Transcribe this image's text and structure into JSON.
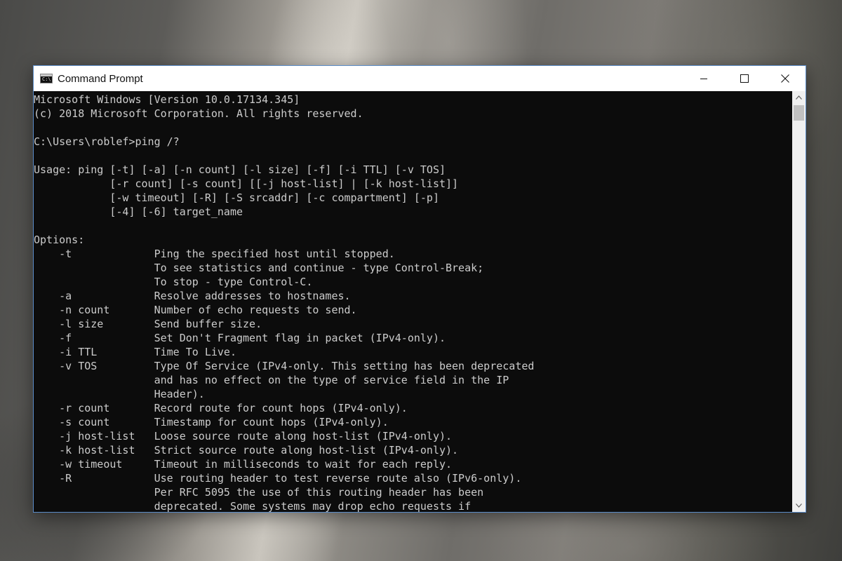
{
  "window": {
    "title": "Command Prompt",
    "icon": "cmd-icon",
    "icon_text": "C:\\"
  },
  "caption_buttons": {
    "minimize_icon": "minimize-icon",
    "maximize_icon": "maximize-icon",
    "close_icon": "close-icon"
  },
  "scrollbar": {
    "up_icon": "chevron-up-icon",
    "down_icon": "chevron-down-icon"
  },
  "console": {
    "lines": [
      "Microsoft Windows [Version 10.0.17134.345]",
      "(c) 2018 Microsoft Corporation. All rights reserved.",
      "",
      "C:\\Users\\roblef>ping /?",
      "",
      "Usage: ping [-t] [-a] [-n count] [-l size] [-f] [-i TTL] [-v TOS]",
      "            [-r count] [-s count] [[-j host-list] | [-k host-list]]",
      "            [-w timeout] [-R] [-S srcaddr] [-c compartment] [-p]",
      "            [-4] [-6] target_name",
      "",
      "Options:",
      "    -t             Ping the specified host until stopped.",
      "                   To see statistics and continue - type Control-Break;",
      "                   To stop - type Control-C.",
      "    -a             Resolve addresses to hostnames.",
      "    -n count       Number of echo requests to send.",
      "    -l size        Send buffer size.",
      "    -f             Set Don't Fragment flag in packet (IPv4-only).",
      "    -i TTL         Time To Live.",
      "    -v TOS         Type Of Service (IPv4-only. This setting has been deprecated",
      "                   and has no effect on the type of service field in the IP",
      "                   Header).",
      "    -r count       Record route for count hops (IPv4-only).",
      "    -s count       Timestamp for count hops (IPv4-only).",
      "    -j host-list   Loose source route along host-list (IPv4-only).",
      "    -k host-list   Strict source route along host-list (IPv4-only).",
      "    -w timeout     Timeout in milliseconds to wait for each reply.",
      "    -R             Use routing header to test reverse route also (IPv6-only).",
      "                   Per RFC 5095 the use of this routing header has been",
      "                   deprecated. Some systems may drop echo requests if"
    ]
  }
}
